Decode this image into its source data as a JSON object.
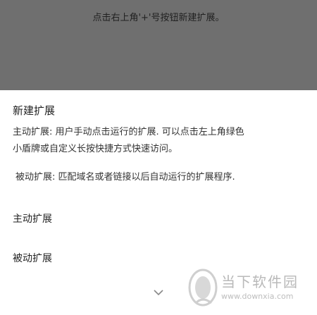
{
  "overlay": {
    "instruction": "点击右上角'+'号按钮新建扩展。"
  },
  "sheet": {
    "title": "新建扩展",
    "active_desc_line1": "主动扩展: 用户手动点击运行的扩展. 可以点击左上角绿色",
    "active_desc_line2": "小盾牌或自定义长按快捷方式快速访问。",
    "passive_desc": "被动扩展: 匹配域名或者链接以后自动运行的扩展程序.",
    "options": [
      {
        "label": "主动扩展"
      },
      {
        "label": "被动扩展"
      }
    ],
    "collapse_icon": "chevron-down-icon"
  },
  "watermark": {
    "name": "当下软件园",
    "url": "www.downxia.com"
  },
  "colors": {
    "overlay": "#6f6f6f",
    "sheet": "#ffffff",
    "text": "#222222",
    "watermark": "#b9b9b9"
  }
}
